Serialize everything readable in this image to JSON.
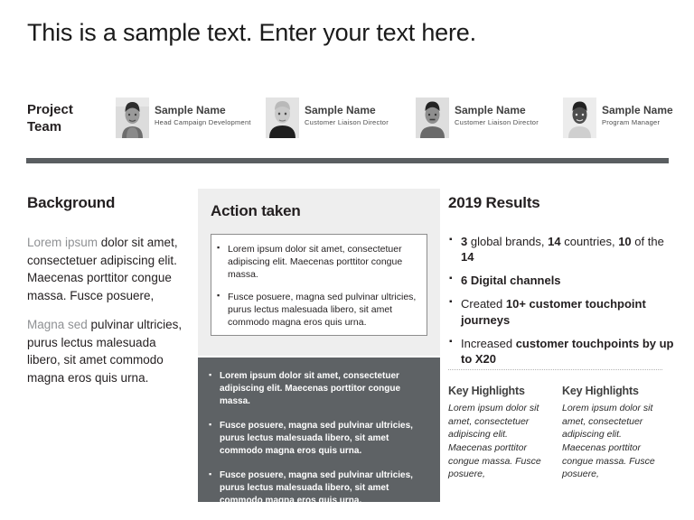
{
  "slide": {
    "title": "This is a sample text. Enter your text here."
  },
  "team": {
    "label": "Project\nTeam",
    "label_line1": "Project",
    "label_line2": "Team",
    "members": [
      {
        "name": "Sample Name",
        "role": "Head Campaign Development",
        "photo": "portrait-photo"
      },
      {
        "name": "Sample Name",
        "role": "Customer Liaison Director",
        "photo": "portrait-photo"
      },
      {
        "name": "Sample Name",
        "role": "Customer Liaison  Director",
        "photo": "portrait-photo"
      },
      {
        "name": "Sample Name",
        "role": "Program Manager",
        "photo": "portrait-photo"
      }
    ]
  },
  "background": {
    "heading": "Background",
    "para1_muted": "Lorem ipsum ",
    "para1_rest": "dolor sit amet, consectetuer adipiscing elit. Maecenas porttitor congue massa. Fusce posuere,",
    "para2_muted": "Magna sed ",
    "para2_rest": "pulvinar ultricies, purus lectus malesuada libero, sit amet commodo magna eros quis urna."
  },
  "action": {
    "heading": "Action taken",
    "white_box_bullets": [
      "Lorem ipsum dolor sit amet, consectetuer adipiscing elit. Maecenas porttitor congue massa.",
      "Fusce posuere, magna sed pulvinar ultricies, purus lectus malesuada libero, sit amet commodo magna eros quis urna."
    ],
    "dark_box_bullets": [
      "Lorem ipsum dolor sit amet, consectetuer adipiscing elit. Maecenas porttitor congue massa.",
      "Fusce posuere, magna sed pulvinar ultricies, purus lectus malesuada libero, sit amet commodo magna eros quis urna.",
      "Fusce posuere, magna sed pulvinar ultricies, purus lectus malesuada libero, sit amet commodo magna eros quis urna."
    ]
  },
  "results": {
    "heading": "2019 Results",
    "bullets": [
      {
        "b1": "3",
        "t1": " global brands, ",
        "b2": "14",
        "t2": " countries, ",
        "b3": "10",
        "t3": " of the ",
        "b4": "14",
        "t4": ""
      },
      {
        "b1": "",
        "t1": "",
        "b2": "6 Digital channels",
        "t2": "",
        "b3": "",
        "t3": "",
        "b4": "",
        "t4": ""
      },
      {
        "b1": "",
        "t1": "Created ",
        "b2": "10+ customer touchpoint journeys",
        "t2": "",
        "b3": "",
        "t3": "",
        "b4": "",
        "t4": ""
      },
      {
        "b1": "",
        "t1": "Increased ",
        "b2": "customer touchpoints by up to X20",
        "t2": "",
        "b3": "",
        "t3": "",
        "b4": "",
        "t4": ""
      }
    ],
    "highlights": [
      {
        "heading": "Key Highlights",
        "body": "Lorem ipsum dolor sit amet, consectetuer adipiscing elit. Maecenas porttitor congue massa. Fusce posuere,"
      },
      {
        "heading": "Key Highlights",
        "body": "Lorem ipsum dolor sit amet, consectetuer adipiscing elit. Maecenas porttitor congue massa. Fusce posuere,"
      }
    ]
  },
  "colors": {
    "dark_panel": "#5e6265",
    "light_panel": "#eeeeee",
    "divider_bar": "#5a5e61",
    "muted_text": "#8f9194",
    "body_text": "#231f20"
  }
}
